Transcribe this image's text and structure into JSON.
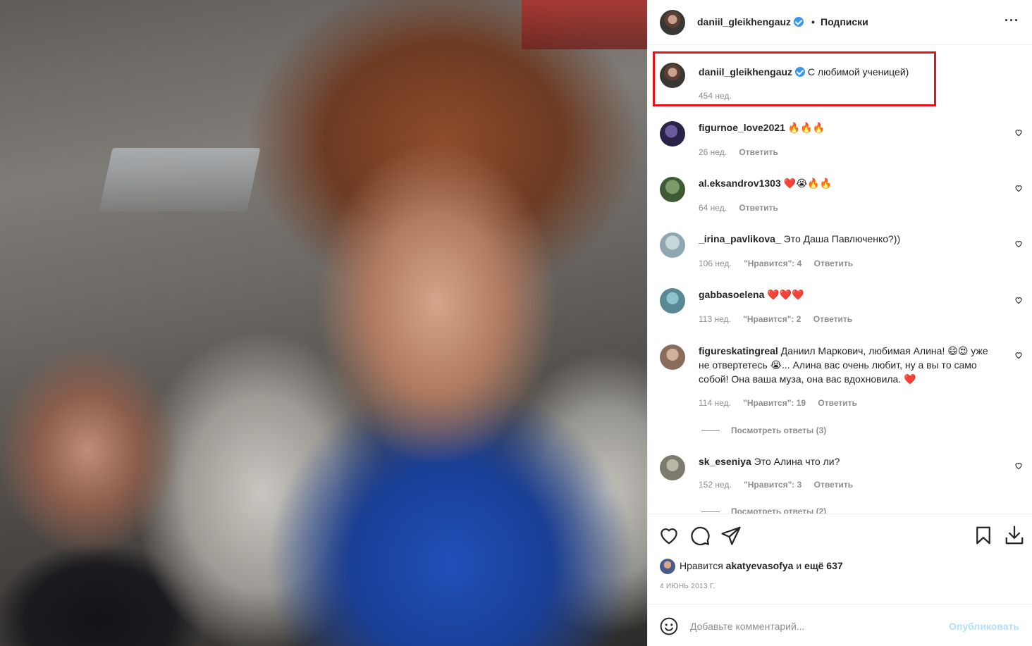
{
  "post": {
    "photo_alt": "",
    "header": {
      "username": "daniil_gleikhengauz",
      "dot": "•",
      "follow_label": "Подписки",
      "more_label": "···"
    },
    "caption": {
      "username": "daniil_gleikhengauz",
      "text": "С любимой ученицей)",
      "time": "454 нед."
    },
    "comments": [
      {
        "username": "figurnoe_love2021",
        "text": "🔥🔥🔥",
        "time": "26 нед.",
        "likes": "",
        "reply": "Ответить"
      },
      {
        "username": "al.eksandrov1303",
        "text": "❤️😭🔥🔥",
        "time": "64 нед.",
        "likes": "",
        "reply": "Ответить"
      },
      {
        "username": "_irina_pavlikova_",
        "text": "Это Даша Павлюченко?))",
        "time": "106 нед.",
        "likes": "\"Нравится\": 4",
        "reply": "Ответить"
      },
      {
        "username": "gabbasoelena",
        "text": "❤️❤️❤️",
        "time": "113 нед.",
        "likes": "\"Нравится\": 2",
        "reply": "Ответить"
      },
      {
        "username": "figureskatingreal",
        "text": "Даниил Маркович, любимая Алина! 😄😍 уже не отвертетесь 😭... Алина вас очень любит, ну а вы то само собой! Она ваша муза, она вас вдохновила. ❤️",
        "time": "114 нед.",
        "likes": "\"Нравится\": 19",
        "reply": "Ответить",
        "view_replies": "Посмотреть ответы (3)"
      },
      {
        "username": "sk_eseniya",
        "text": "Это Алина что ли?",
        "time": "152 нед.",
        "likes": "\"Нравится\": 3",
        "reply": "Ответить",
        "view_replies": "Посмотреть ответы (2)"
      }
    ],
    "actions": {
      "like_icon": "heart-icon",
      "comment_icon": "comment-icon",
      "share_icon": "share-icon",
      "save_icon": "bookmark-icon",
      "download_icon": "download-icon"
    },
    "likes": {
      "prefix": "Нравится",
      "user": "akatyevasofya",
      "middle": "и",
      "rest": "ещё 637"
    },
    "date": "4 ИЮНЬ 2013 Г.",
    "add_comment": {
      "placeholder": "Добавьте комментарий...",
      "publish_label": "Опубликовать"
    }
  },
  "colors": {
    "highlight": "#e4141b",
    "verified": "#3897f0",
    "publish_disabled": "#b2dffc",
    "muted": "#8e8e8e"
  }
}
